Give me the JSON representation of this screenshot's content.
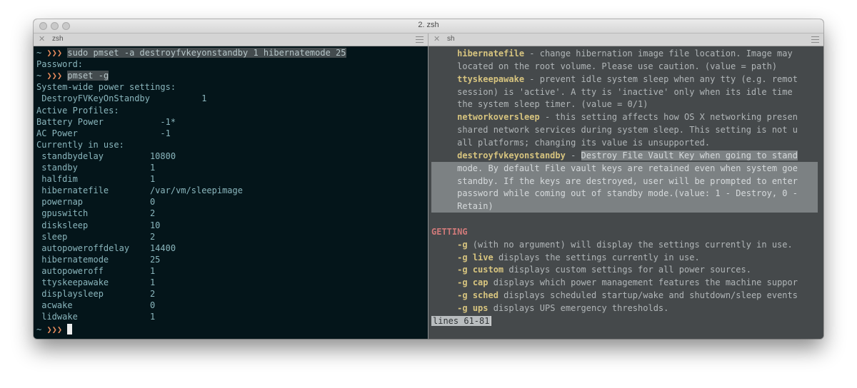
{
  "window": {
    "title": "2. zsh",
    "traffic_lights": [
      "close-button",
      "minimize-button",
      "zoom-button"
    ]
  },
  "tabs": {
    "left": {
      "close": "✕",
      "label": "zsh"
    },
    "right": {
      "close": "✕",
      "label": "sh"
    }
  },
  "left_pane": {
    "lines": [
      {
        "prompt": "~ ",
        "arrows": "❯❯❯",
        "cmd": "sudo pmset -a destroyfvkeyonstandby 1 hibernatemode 25"
      },
      {
        "text": "Password:"
      },
      {
        "prompt": "~ ",
        "arrows": "❯❯❯",
        "cmd": "pmset -g"
      },
      {
        "text": "System-wide power settings:"
      },
      {
        "text": " DestroyFVKeyOnStandby          1"
      },
      {
        "text": "Active Profiles:"
      },
      {
        "text": "Battery Power           -1*"
      },
      {
        "text": "AC Power                -1"
      },
      {
        "text": "Currently in use:"
      },
      {
        "text": " standbydelay         10800"
      },
      {
        "text": " standby              1"
      },
      {
        "text": " halfdim              1"
      },
      {
        "text": " hibernatefile        /var/vm/sleepimage"
      },
      {
        "text": " powernap             0"
      },
      {
        "text": " gpuswitch            2"
      },
      {
        "text": " disksleep            10"
      },
      {
        "text": " sleep                2"
      },
      {
        "text": " autopoweroffdelay    14400"
      },
      {
        "text": " hibernatemode        25"
      },
      {
        "text": " autopoweroff         1"
      },
      {
        "text": " ttyskeepawake        1"
      },
      {
        "text": " displaysleep         2"
      },
      {
        "text": " acwake               0"
      },
      {
        "text": " lidwake              1"
      }
    ],
    "final_prompt": {
      "prompt": "~ ",
      "arrows": "❯❯❯"
    }
  },
  "right_pane": {
    "lines": [
      {
        "kw": "hibernatefile",
        "rest": " - change hibernation image file location. Image may"
      },
      {
        "rest": "located on the root volume. Please use caution. (value = path)"
      },
      {
        "kw": "ttyskeepawake",
        "rest": " - prevent idle system sleep when any tty (e.g. remot"
      },
      {
        "rest": "session) is 'active'. A tty is 'inactive' only when its idle time"
      },
      {
        "rest": "the system sleep timer. (value = 0/1)"
      },
      {
        "kw": "networkoversleep",
        "rest": " - this setting affects how OS X networking presen"
      },
      {
        "rest": "shared network services during system sleep. This setting is not u"
      },
      {
        "rest": "all platforms; changing its value is unsupported."
      },
      {
        "kw": "destroyfvkeyonstandby",
        "rest": " - ",
        "selected": "Destroy File Vault Key when going to stand"
      },
      {
        "rest": "mode. By default File vault keys are retained even when system goe",
        "sel": true
      },
      {
        "rest": "standby. If the keys are destroyed, user will be prompted to enter",
        "sel": true
      },
      {
        "rest": "password while coming out of standby mode.(value: 1 - Destroy, 0 -",
        "sel": true
      },
      {
        "rest": "Retain)",
        "sel": true
      }
    ],
    "section": "GETTING",
    "getting": [
      {
        "opt": "-g",
        "rest": " (with no argument) will display the settings currently in use."
      },
      {
        "opt": "-g",
        "arg": "live",
        "rest": " displays the settings currently in use."
      },
      {
        "opt": "-g",
        "arg": "custom",
        "rest": " displays custom settings for all power sources."
      },
      {
        "opt": "-g",
        "arg": "cap",
        "rest": " displays which power management features the machine suppor"
      },
      {
        "opt": "-g",
        "arg": "sched",
        "rest": " displays scheduled startup/wake and shutdown/sleep events"
      },
      {
        "opt": "-g",
        "arg": "ups",
        "rest": " displays UPS emergency thresholds."
      }
    ],
    "status": "lines 61-81"
  },
  "colors": {
    "left_bg": "#04151a",
    "right_bg": "#45494b",
    "prompt_arrows": "#e68a5c",
    "keyword": "#d7c47f",
    "section": "#d07a7a",
    "selection": "#7c8183"
  }
}
